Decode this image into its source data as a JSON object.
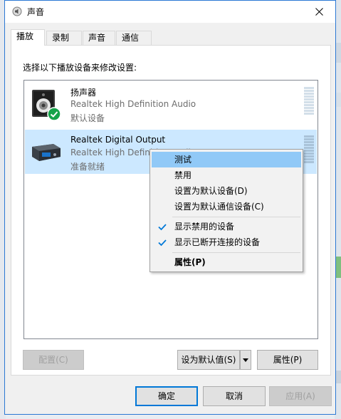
{
  "window": {
    "title": "声音",
    "icon": "speaker-volume-icon",
    "accent": "#2b78d4"
  },
  "tabs": [
    {
      "label": "播放",
      "active": true
    },
    {
      "label": "录制",
      "active": false
    },
    {
      "label": "声音",
      "active": false
    },
    {
      "label": "通信",
      "active": false
    }
  ],
  "instruction": "选择以下播放设备来修改设置:",
  "devices": [
    {
      "name": "扬声器",
      "driver": "Realtek High Definition Audio",
      "status": "默认设备",
      "icon": "speaker-icon",
      "badge": "default-check-icon",
      "selected": false
    },
    {
      "name": "Realtek Digital Output",
      "driver": "Realtek High Definition Audio",
      "status": "准备就绪",
      "icon": "digital-output-icon",
      "selected": true
    }
  ],
  "context_menu": {
    "items": [
      {
        "label": "测试",
        "hover": true
      },
      {
        "label": "禁用"
      },
      {
        "label": "设置为默认设备(D)"
      },
      {
        "label": "设置为默认通信设备(C)"
      },
      {
        "label": "显示禁用的设备",
        "checked": true
      },
      {
        "label": "显示已断开连接的设备",
        "checked": true
      },
      {
        "label": "属性(P)",
        "bold": true
      }
    ]
  },
  "panel_buttons": {
    "configure": "配置(C)",
    "set_default": "设为默认值(S)",
    "properties": "属性(P)"
  },
  "dialog_buttons": {
    "ok": "确定",
    "cancel": "取消",
    "apply": "应用(A)"
  },
  "colors": {
    "selection": "#cce8ff",
    "menu_hover": "#91c9f7",
    "check_blue": "#0078d7",
    "meter": "#c9d7e3"
  }
}
